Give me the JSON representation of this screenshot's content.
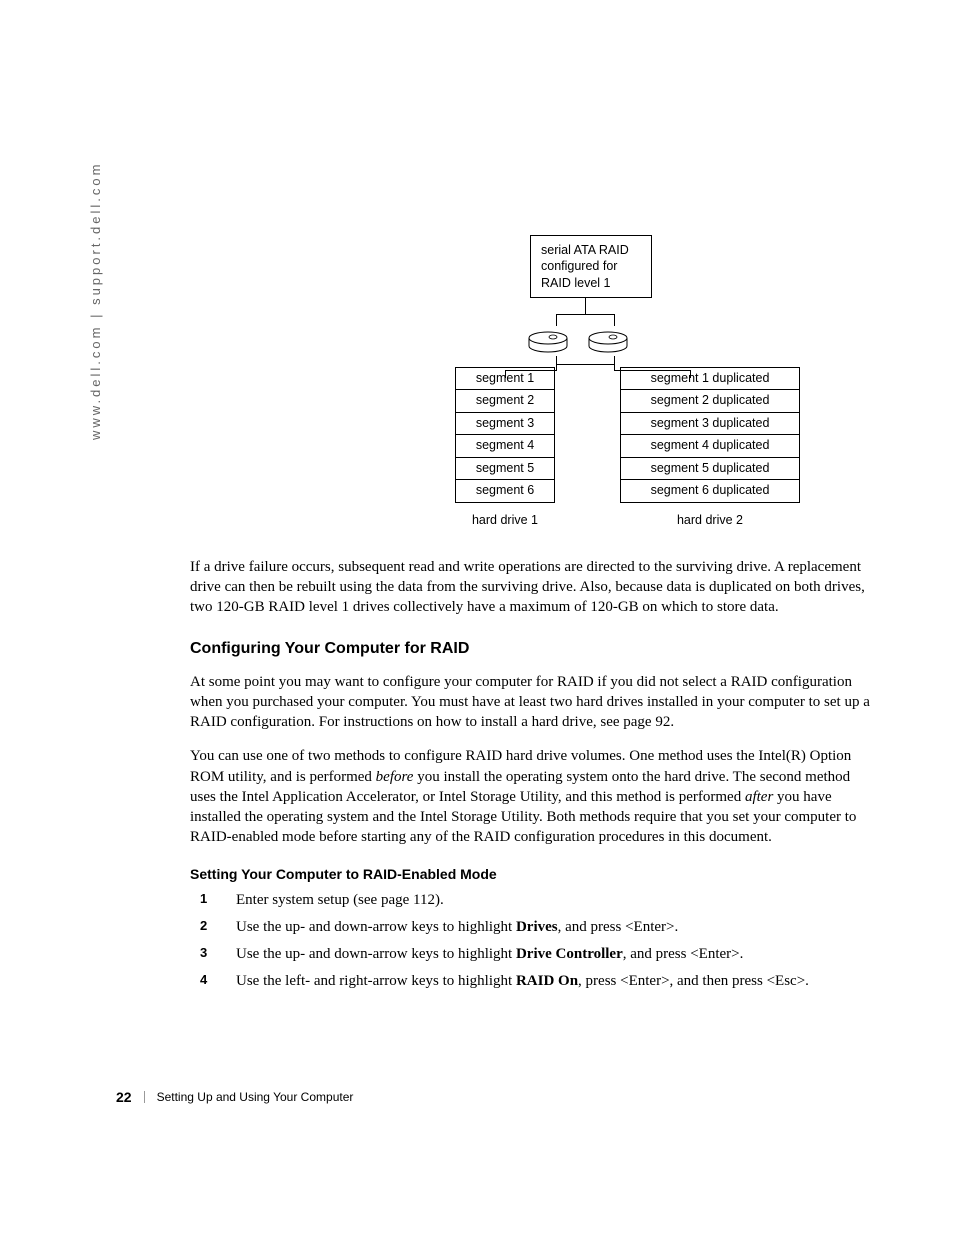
{
  "sidebar": "www.dell.com | support.dell.com",
  "diagram": {
    "top_label_l1": "serial ATA RAID",
    "top_label_l2": "configured for",
    "top_label_l3": "RAID level 1",
    "left_col": [
      "segment 1",
      "segment 2",
      "segment 3",
      "segment 4",
      "segment 5",
      "segment 6"
    ],
    "right_col": [
      "segment 1 duplicated",
      "segment 2 duplicated",
      "segment 3 duplicated",
      "segment 4 duplicated",
      "segment 5 duplicated",
      "segment 6 duplicated"
    ],
    "hd_left": "hard drive 1",
    "hd_right": "hard drive 2"
  },
  "para1": "If a drive failure occurs, subsequent read and write operations are directed to the surviving drive. A replacement drive can then be rebuilt using the data from the surviving drive. Also, because data is duplicated on both drives, two 120-GB RAID level 1 drives collectively have a maximum of 120-GB on which to store data.",
  "heading1": "Configuring Your Computer for RAID",
  "para2": "At some point you may want to configure your computer for RAID if you did not select a RAID configuration when you purchased your computer. You must have at least two hard drives installed in your computer to set up a RAID configuration. For instructions on how to install a hard drive, see page 92.",
  "para3_a": "You can use one of two methods to configure RAID hard drive volumes. One method uses the Intel(R) Option ROM utility, and is performed ",
  "para3_before": "before",
  "para3_b": " you install the operating system onto the hard drive. The second method uses the Intel Application Accelerator, or Intel Storage Utility, and this method is performed ",
  "para3_after": "after",
  "para3_c": " you have installed the operating system and the Intel Storage Utility. Both methods require that you set your computer to RAID-enabled mode before starting any of the RAID configuration procedures in this document.",
  "heading2": "Setting Your Computer to RAID-Enabled Mode",
  "steps": {
    "s1": "Enter system setup (see page 112).",
    "s2_a": "Use the up- and down-arrow keys to highlight ",
    "s2_b": "Drives",
    "s2_c": ", and press <Enter>.",
    "s3_a": "Use the up- and down-arrow keys to highlight ",
    "s3_b": "Drive Controller",
    "s3_c": ", and press <Enter>.",
    "s4_a": "Use the left- and right-arrow keys to highlight ",
    "s4_b": "RAID On",
    "s4_c": ", press <Enter>, and then press <Esc>."
  },
  "footer": {
    "page": "22",
    "section": "Setting Up and Using Your Computer"
  }
}
